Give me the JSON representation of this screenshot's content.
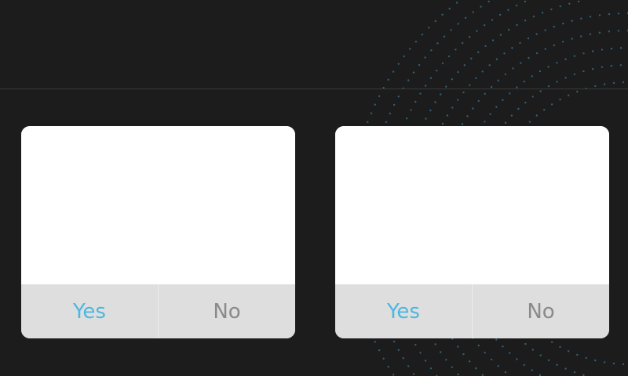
{
  "colors": {
    "background": "#1c1c1c",
    "divider": "#3a3a3a",
    "dialog_body": "#ffffff",
    "dialog_footer": "#dedede",
    "yes_accent": "#4cb8df",
    "no_text": "#8a8a8a",
    "dot_pattern": "#3b7c9c"
  },
  "dialogs": [
    {
      "yes_label": "Yes",
      "no_label": "No"
    },
    {
      "yes_label": "Yes",
      "no_label": "No"
    }
  ]
}
